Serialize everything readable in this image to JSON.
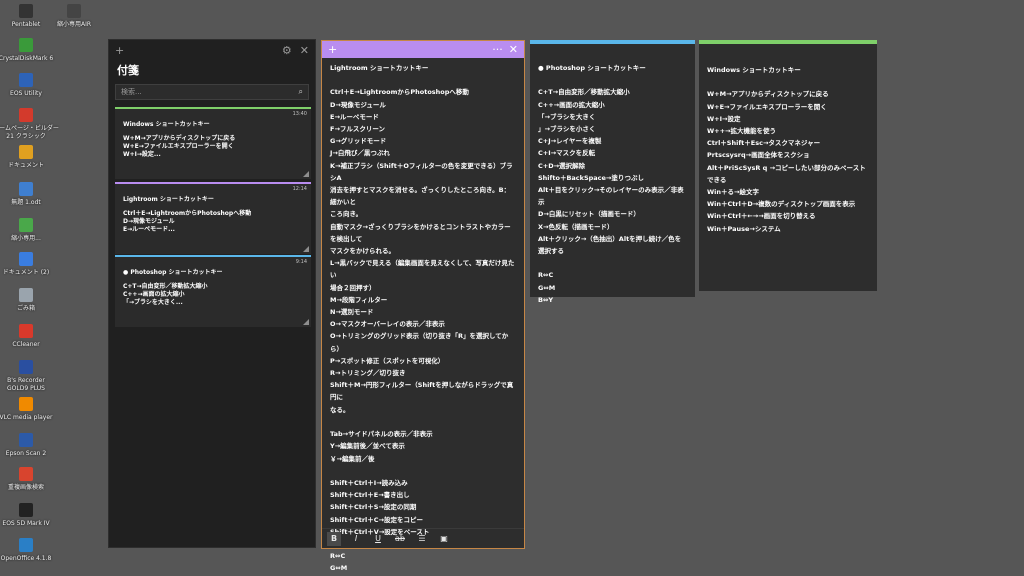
{
  "desktop_icons": [
    {
      "label": "Pentablet",
      "icon": "pentablet-icon",
      "color": "#333333"
    },
    {
      "label": "縮小専用AIR",
      "icon": "shrink-app-icon",
      "color": "#444444"
    },
    {
      "label": "CrystalDiskMark 6",
      "icon": "crystaldiskmark-icon",
      "color": "#3a9a3a"
    },
    {
      "label": "EOS Utility",
      "icon": "eos-utility-icon",
      "color": "#2d63b8"
    },
    {
      "label": "ホームページ・ビルダー\n21 クラシック",
      "icon": "homepage-builder-icon",
      "color": "#d33a2c"
    },
    {
      "label": "ドキュメント",
      "icon": "documents-icon",
      "color": "#e0a020"
    },
    {
      "label": "無題 1.odt",
      "icon": "odt-file-icon",
      "color": "#3f7fd0"
    },
    {
      "label": "縮小専用...",
      "icon": "shrink-shortcut-icon",
      "color": "#4aa84a"
    },
    {
      "label": "ドキュメント (2)",
      "icon": "documents-2-icon",
      "color": "#3a7de0"
    },
    {
      "label": "ごみ箱",
      "icon": "recycle-bin-icon",
      "color": "#9aa4ad"
    },
    {
      "label": "CCleaner",
      "icon": "ccleaner-icon",
      "color": "#d9392b"
    },
    {
      "label": "B's Recorder\nGOLD9 PLUS",
      "icon": "bs-recorder-icon",
      "color": "#2a4fa0"
    },
    {
      "label": "VLC media player",
      "icon": "vlc-icon",
      "color": "#f08a00"
    },
    {
      "label": "Epson Scan 2",
      "icon": "epson-scan-icon",
      "color": "#2c5aa8"
    },
    {
      "label": "重複画像検索",
      "icon": "duplicate-image-icon",
      "color": "#d8442e"
    },
    {
      "label": "EOS 5D Mark IV",
      "icon": "camera-icon",
      "color": "#222222"
    },
    {
      "label": "OpenOffice 4.1.8",
      "icon": "openoffice-icon",
      "color": "#2a7fc6"
    }
  ],
  "panel": {
    "title": "付箋",
    "add_glyph": "+",
    "settings_glyph": "⚙",
    "close_glyph": "✕",
    "search_placeholder": "検索...",
    "search_glyph": "⌕",
    "cards": [
      {
        "time": "13:40",
        "title": "Windows ショートカットキー",
        "body": "W+M→アプリからディスクトップに戻る\nW+E→ファイルエキスプローラーを開く\nW+I→設定...",
        "color": "#7fd06a"
      },
      {
        "time": "12:14",
        "title": "Lightroom ショートカットキー",
        "body": "Ctrl＋E→LightroomからPhotoshopへ移動\nD→現像モジュール\nE→ルーペモード...",
        "color": "#b98df0"
      },
      {
        "time": "9:14",
        "title": "● Photoshop ショートカットキー",
        "body": "C+T→自由変形／移動拡大縮小\nC++→画面の拡大縮小\n「→ブラシを大きく...",
        "color": "#5ab7ea"
      }
    ]
  },
  "notes": {
    "lightroom": {
      "add_glyph": "+",
      "menu_glyph": "···",
      "close_glyph": "✕",
      "content": "Lightroom ショートカットキー\n\nCtrl＋E→LightroomからPhotoshopへ移動\nD→現像モジュール\nE→ルーペモード\nF→フルスクリーン\nG→グリッドモード\nJ→白飛び／黒つぶれ\nK→補正ブラシ（Shift＋Oフィルターの色を変更できる）ブラシA\n消去を押すとマスクを消せる。ざっくりしたところ向き。B：細かいと\nころ向き。\n自動マスク→ざっくりブラシをかけるとコントラストやカラーを検出して\nマスクをかけられる。\nL→黒バックで見える（編集画面を見えなくして、写真だけ見たい\n場合２回押す）\nM→段階フィルター\nN→選別モード\nO→マスクオーバーレイの表示／非表示\nO→トリミングのグリッド表示（切り抜き「R」を選択してから）\nP→スポット修正（スポットを可視化）\nR→トリミング／切り抜き\nShift＋M→円形フィルター（Shiftを押しながらドラッグで真円に\nなる。\n\nTab→サイドパネルの表示／非表示\nY→編集前後／並べて表示\n￥→編集前／後\n\nShift＋Ctrl＋I→読み込み\nShift＋Ctrl＋E→書き出し\nShift＋Ctrl＋S→設定の同期\nShift＋Ctrl＋C→設定をコピー\nShift＋Ctrl＋V→設定をペースト\n\nR⇔C\nG⇔M\nB⇔Y",
      "toolbar": {
        "bold": "B",
        "italic": "I",
        "underline": "U",
        "strike": "ab",
        "list": "☰",
        "image": "▣"
      }
    },
    "photoshop": {
      "color": "#5ab7ea",
      "content": "● Photoshop ショートカットキー\n\nC+T→自由変形／移動拡大縮小\nC++→画面の拡大縮小\n「→ブラシを大きく\n」→ブラシを小さく\nC+J→レイヤーを複製\nC+I→マスクを反転\nC+D→選択解除\nShifto＋BackSpace→塗りつぶし\nAlt＋目をクリック→そのレイヤーのみ表示／非表示\nD→白黒にリセット（描画モード）\nX→色反転（描画モード）\nAlt＋クリック→（色抽出）Altを押し続け／色を\n選択する\n\nR⇔C\nG⇔M\nB⇔Y"
    },
    "windows": {
      "color": "#7fd06a",
      "content": "Windows ショートカットキー\n\nW+M→アプリからディスクトップに戻る\nW+E→ファイルエキスプローラーを開く\nW+I→設定\nW++→拡大機能を使う\nCtrl＋Shift＋Esc→タスクマネジャー\nPrtscsysrq→画面全体をスクショ\nAlt＋PriScSysR q →コピーしたい部分のみペーストできる\nWin＋る→絵文字\nWin＋Ctrl＋D→複数のディスクトップ画面を表示\nWin＋Ctrl＋←→→画面を切り替える\nWin＋Pause→システム"
    }
  }
}
